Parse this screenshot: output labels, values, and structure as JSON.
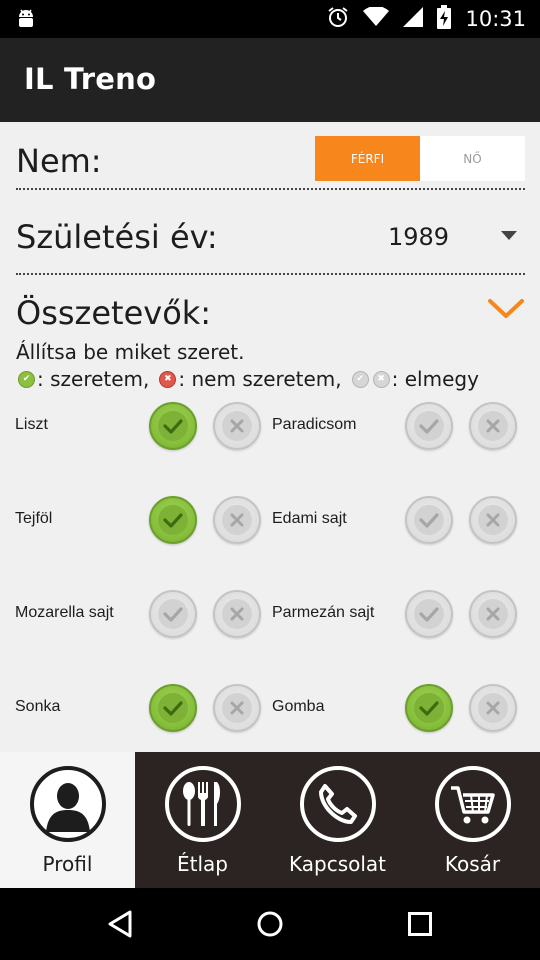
{
  "status_bar": {
    "time": "10:31",
    "icons": [
      "android-icon",
      "alarm-icon",
      "wifi-icon",
      "signal-icon",
      "battery-charging-icon"
    ]
  },
  "action_bar": {
    "title": "IL Treno"
  },
  "gender": {
    "label": "Nem:",
    "options": [
      "FÉRFI",
      "NŐ"
    ],
    "selected": "FÉRFI"
  },
  "birth_year": {
    "label": "Születési év:",
    "value": "1989"
  },
  "ingredients": {
    "label": "Összetevők:",
    "instruction": "Állítsa be miket szeret.",
    "legend": {
      "like": ": szeretem,",
      "dislike": ": nem szeretem,",
      "neutral": ": elmegy"
    },
    "items": [
      {
        "name": "Liszt",
        "state": "like"
      },
      {
        "name": "Paradicsom",
        "state": "neutral"
      },
      {
        "name": "Tejföl",
        "state": "like"
      },
      {
        "name": "Edami sajt",
        "state": "neutral"
      },
      {
        "name": "Mozarella sajt",
        "state": "neutral"
      },
      {
        "name": "Parmezán sajt",
        "state": "neutral"
      },
      {
        "name": "Sonka",
        "state": "like"
      },
      {
        "name": "Gomba",
        "state": "like"
      }
    ]
  },
  "bottom_nav": {
    "items": [
      {
        "label": "Profil",
        "icon": "person-icon",
        "active": true
      },
      {
        "label": "Étlap",
        "icon": "cutlery-icon",
        "active": false
      },
      {
        "label": "Kapcsolat",
        "icon": "phone-icon",
        "active": false
      },
      {
        "label": "Kosár",
        "icon": "cart-icon",
        "active": false
      }
    ]
  },
  "system_nav": [
    "back-icon",
    "home-icon",
    "recents-icon"
  ],
  "colors": {
    "accent": "#f7861c",
    "like_green": "#86bf3c",
    "dislike_red": "#e2574c",
    "bottom_nav_bg": "#2c2422"
  }
}
